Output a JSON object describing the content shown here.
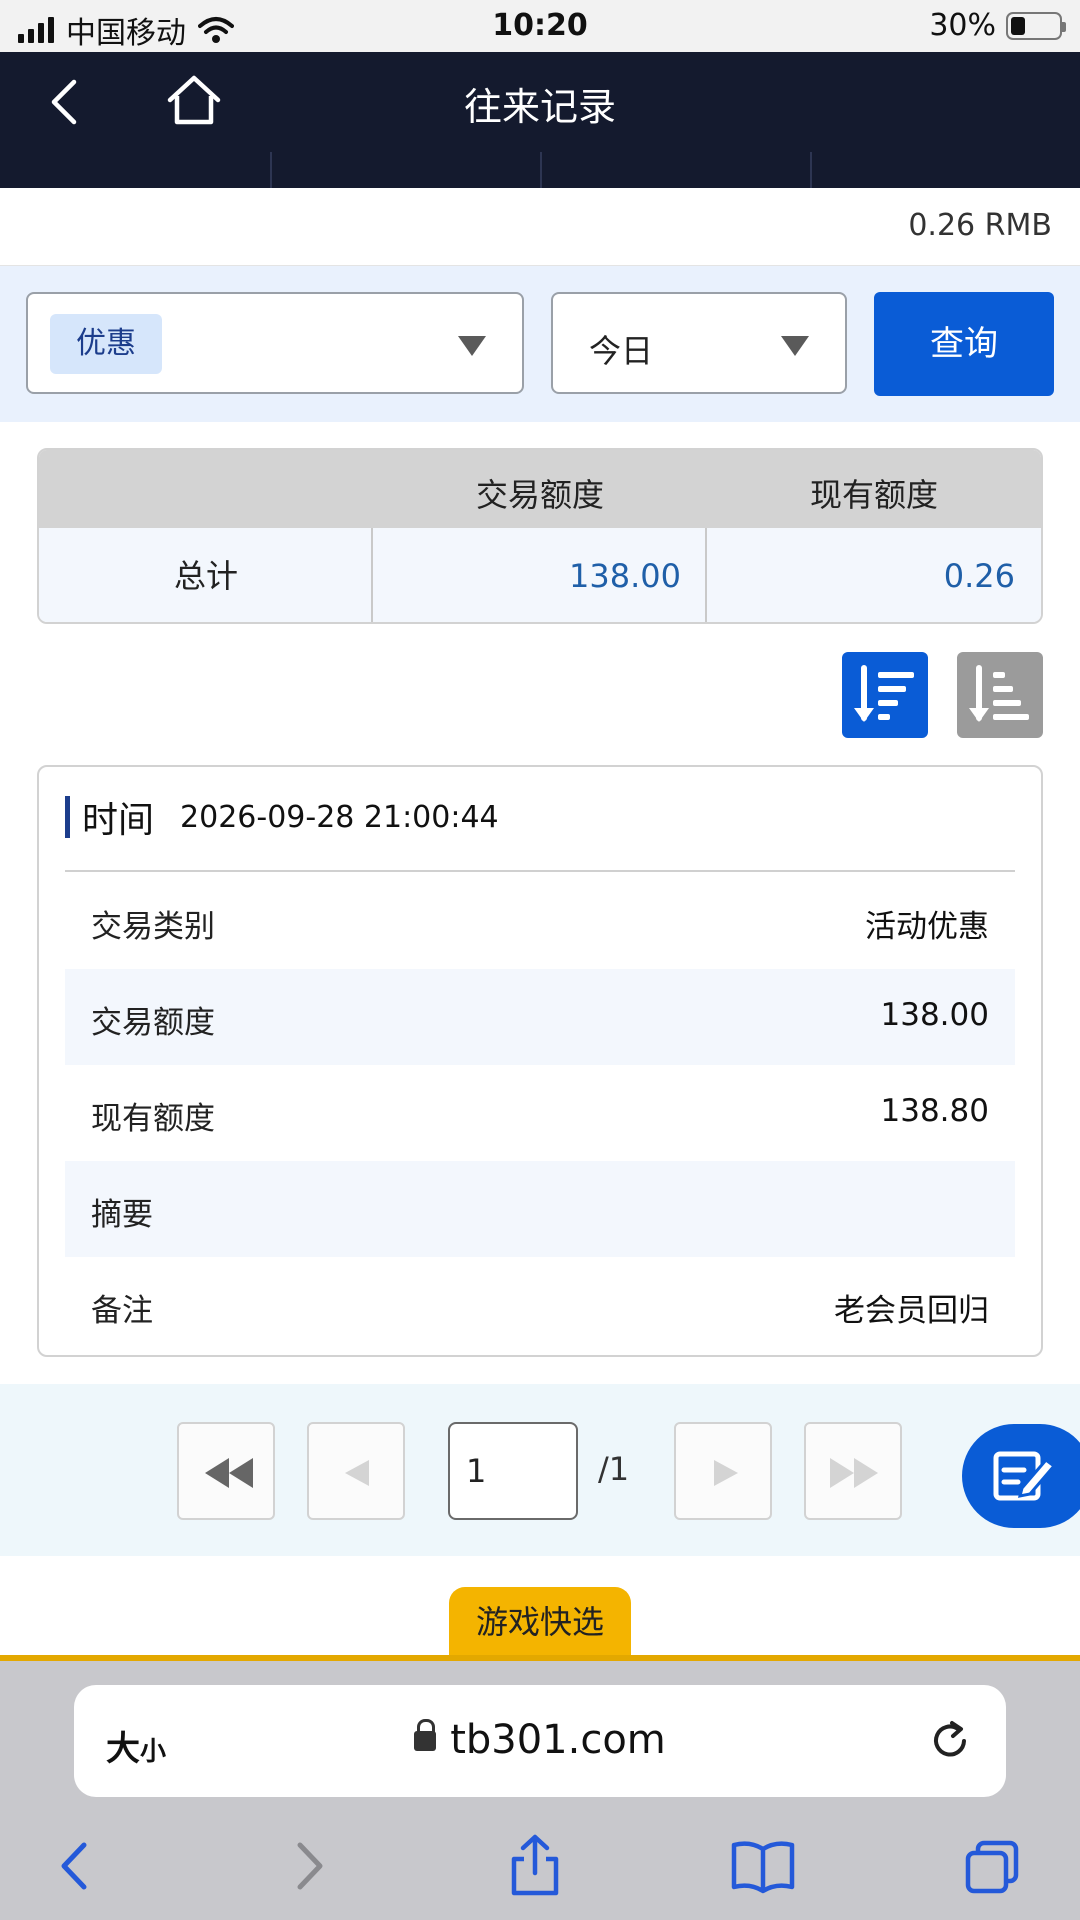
{
  "status_bar": {
    "carrier": "中国移动",
    "time": "10:20",
    "battery": "30%",
    "battery_level": 0.3
  },
  "header": {
    "title": "往来记录",
    "back_icon": "chevron-left-icon",
    "home_icon": "home-icon"
  },
  "balance": {
    "value": "0.26 RMB"
  },
  "filter": {
    "type_selected": "优惠",
    "date_selected": "今日",
    "query_label": "查询"
  },
  "summary": {
    "headers": [
      "",
      "交易额度",
      "现有额度"
    ],
    "row_label": "总计",
    "transaction_amount": "138.00",
    "current_amount": "0.26",
    "value_color": "#1f5fa8"
  },
  "record": {
    "time_label": "时间",
    "time_value": "2026-09-28 21:00:44",
    "rows": [
      {
        "key": "交易类别",
        "value": "活动优惠"
      },
      {
        "key": "交易额度",
        "value": "138.00"
      },
      {
        "key": "现有额度",
        "value": "138.80"
      },
      {
        "key": "摘要",
        "value": ""
      },
      {
        "key": "备注",
        "value": "老会员回归"
      }
    ]
  },
  "pagination": {
    "current_page": "1",
    "total": "/1"
  },
  "quick_tab": {
    "label": "游戏快选"
  },
  "browser": {
    "text_size": "大",
    "text_size_small": "小",
    "url": "tb301.com"
  },
  "colors": {
    "nav_bg": "#141a2e",
    "accent_blue": "#0a5cd6",
    "quick_tab": "#f4b400"
  }
}
